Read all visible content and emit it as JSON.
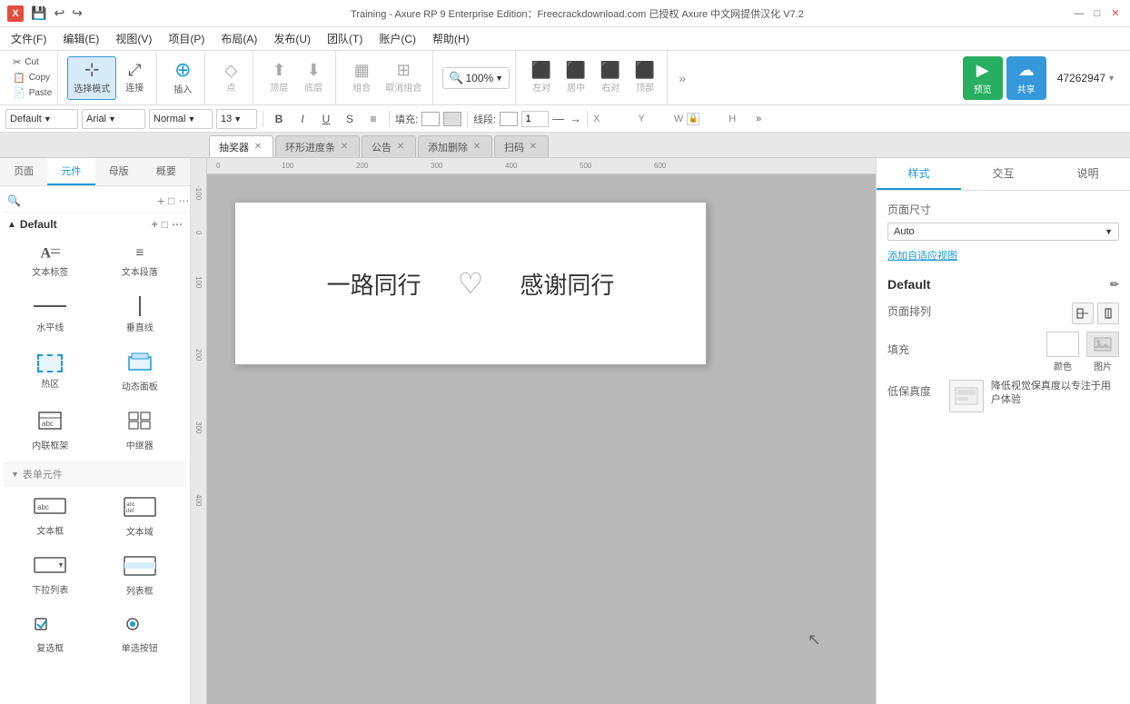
{
  "titlebar": {
    "title": "Training - Axure RP 9 Enterprise Edition：Freecrackdownload.com 已授权   Axure 中文网提供汉化 V7.2",
    "minimize": "—",
    "maximize": "□",
    "close": "✕"
  },
  "menu": {
    "items": [
      "文件(F)",
      "编辑(E)",
      "视图(V)",
      "项目(P)",
      "布局(A)",
      "发布(U)",
      "团队(T)",
      "账户(C)",
      "帮助(H)"
    ]
  },
  "toolbar": {
    "clipboard": {
      "cut": "Cut",
      "copy": "Copy",
      "paste": "Paste"
    },
    "modes": {
      "select": "选择模式",
      "connect": "连接"
    },
    "insert": "插入",
    "point": "点",
    "layers": {
      "top": "顶层",
      "bottom": "底层"
    },
    "group": {
      "group": "组合",
      "ungroup": "取消组合"
    },
    "zoom": "100%",
    "align": {
      "left": "左对",
      "center": "居中",
      "right": "右对",
      "top": "顶部"
    },
    "more": "»",
    "preview": "预览",
    "share": "共享",
    "project_id": "47262947"
  },
  "format_bar": {
    "layer": "Default",
    "font": "Arial",
    "style": "Normal",
    "size": "13",
    "bold": "B",
    "italic": "I",
    "underline": "U",
    "strikethrough": "S",
    "align": "≡",
    "fill_label": "填充:",
    "stroke_label": "线段:",
    "stroke_width": "1",
    "x_label": "X",
    "y_label": "Y",
    "w_label": "W",
    "h_label": "H",
    "more": "»"
  },
  "tabs": {
    "items": [
      {
        "label": "抽奖器",
        "active": true
      },
      {
        "label": "环形进度条",
        "active": false
      },
      {
        "label": "公告",
        "active": false
      },
      {
        "label": "添加删除",
        "active": false
      },
      {
        "label": "扫码",
        "active": false
      }
    ]
  },
  "left_panel": {
    "nav_tabs": [
      "页面",
      "元件",
      "母版",
      "概要"
    ],
    "active_tab": "元件",
    "search_placeholder": "",
    "group_name": "Default",
    "group_actions": [
      "+",
      "□",
      "⋯"
    ],
    "widgets": [
      {
        "icon": "A—",
        "label": "文本标签"
      },
      {
        "icon": "≡A",
        "label": "文本段落"
      },
      {
        "icon": "—",
        "label": "水平线"
      },
      {
        "icon": "|",
        "label": "垂直线"
      },
      {
        "icon": "⊞",
        "label": "热区"
      },
      {
        "icon": "◱",
        "label": "动态面板"
      },
      {
        "icon": "▦",
        "label": "内联框架"
      },
      {
        "icon": "⊞⊞",
        "label": "中继器"
      }
    ],
    "form_section": "表单元件",
    "form_widgets": [
      {
        "icon": "abc",
        "label": "文本框"
      },
      {
        "icon": "≡abc",
        "label": "文本域"
      },
      {
        "icon": "▼",
        "label": "下拉列表"
      },
      {
        "icon": "▦",
        "label": "列表框"
      },
      {
        "icon": "☑",
        "label": "复选框"
      },
      {
        "icon": "◉",
        "label": "单选按钮"
      }
    ]
  },
  "canvas": {
    "zoom": 100,
    "text_left": "一路同行",
    "text_right": "感谢同行",
    "heart": "♡",
    "ruler_labels": [
      "0",
      "100",
      "200",
      "300",
      "400",
      "500",
      "600"
    ],
    "ruler_v_labels": [
      "-100",
      "0",
      "100",
      "200",
      "300",
      "400"
    ]
  },
  "right_panel": {
    "tabs": [
      "样式",
      "交互",
      "说明"
    ],
    "active_tab": "样式",
    "page_size_label": "页面尺寸",
    "page_size_value": "Auto",
    "adaptive_link": "添加自适应视图",
    "section_title": "Default",
    "layout_label": "页面排列",
    "fill_label": "填充",
    "fill_color": "颜色",
    "fill_image": "图片",
    "fidelity_label": "低保真度",
    "fidelity_desc": "降低视觉保真度以专注于用户体验"
  }
}
